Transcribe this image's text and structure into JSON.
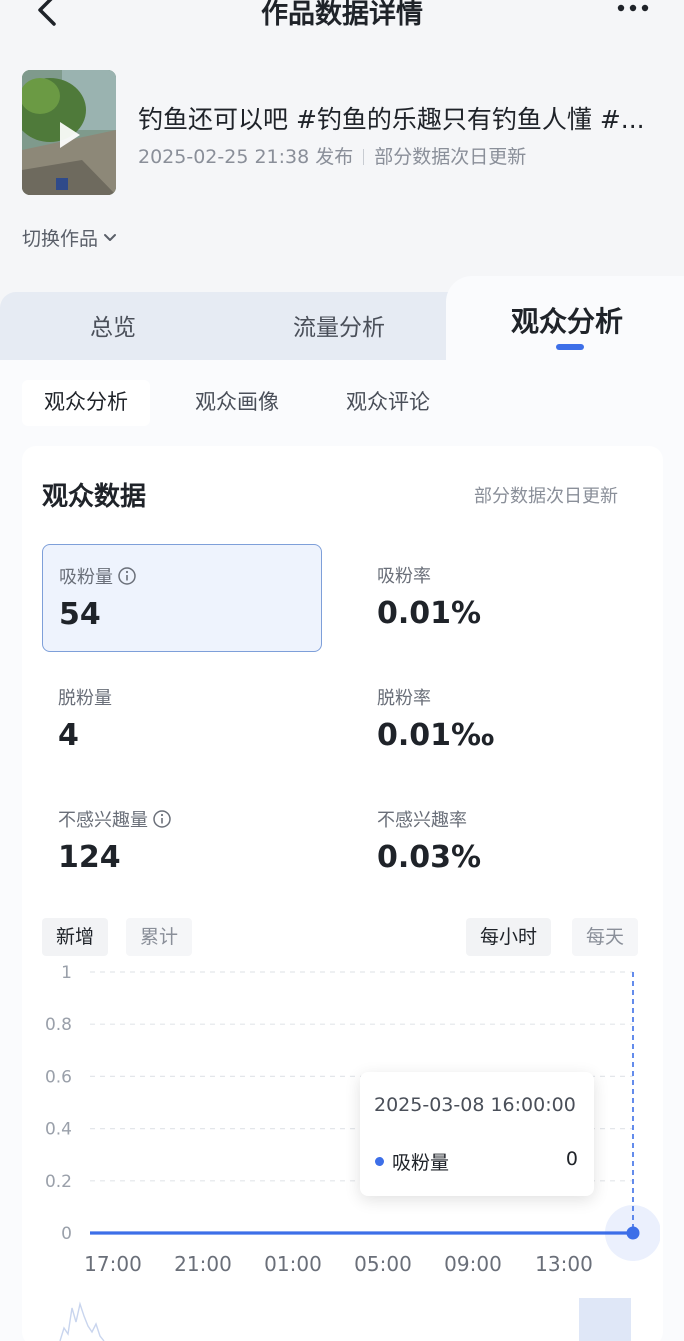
{
  "header": {
    "title": "作品数据详情"
  },
  "work": {
    "title": "钓鱼还可以吧 #钓鱼的乐趣只有钓鱼人懂 #...",
    "publish_time": "2025-02-25 21:38 发布",
    "update_note": "部分数据次日更新",
    "switch_label": "切换作品"
  },
  "tabs": [
    {
      "label": "总览"
    },
    {
      "label": "流量分析"
    },
    {
      "label": "观众分析"
    }
  ],
  "subtabs": [
    {
      "label": "观众分析"
    },
    {
      "label": "观众画像"
    },
    {
      "label": "观众评论"
    }
  ],
  "panel": {
    "title": "观众数据",
    "note": "部分数据次日更新"
  },
  "metrics": [
    {
      "label": "吸粉量",
      "value": "54"
    },
    {
      "label": "吸粉率",
      "value": "0.01%"
    },
    {
      "label": "脱粉量",
      "value": "4"
    },
    {
      "label": "脱粉率",
      "value": "0.01‰"
    },
    {
      "label": "不感兴趣量",
      "value": "124"
    },
    {
      "label": "不感兴趣率",
      "value": "0.03%"
    }
  ],
  "toggles": {
    "mode": [
      "新增",
      "累计"
    ],
    "granularity": [
      "每小时",
      "每天"
    ]
  },
  "tooltip": {
    "time": "2025-03-08 16:00:00",
    "label": "吸粉量",
    "value": "0"
  },
  "colors": {
    "accent": "#3d6fe8",
    "selected_bg": "#eef3fd",
    "selected_border": "#7e9fd9"
  },
  "chart_data": {
    "type": "line",
    "x": [
      "17:00",
      "21:00",
      "01:00",
      "05:00",
      "09:00",
      "13:00"
    ],
    "series": [
      {
        "values": [
          0,
          0,
          0,
          0,
          0,
          0,
          0
        ]
      }
    ],
    "yticks": [
      "1",
      "0.8",
      "0.6",
      "0.4",
      "0.2",
      "0"
    ],
    "ylim": [
      0,
      1
    ],
    "grid": true,
    "highlight_index": 6
  }
}
